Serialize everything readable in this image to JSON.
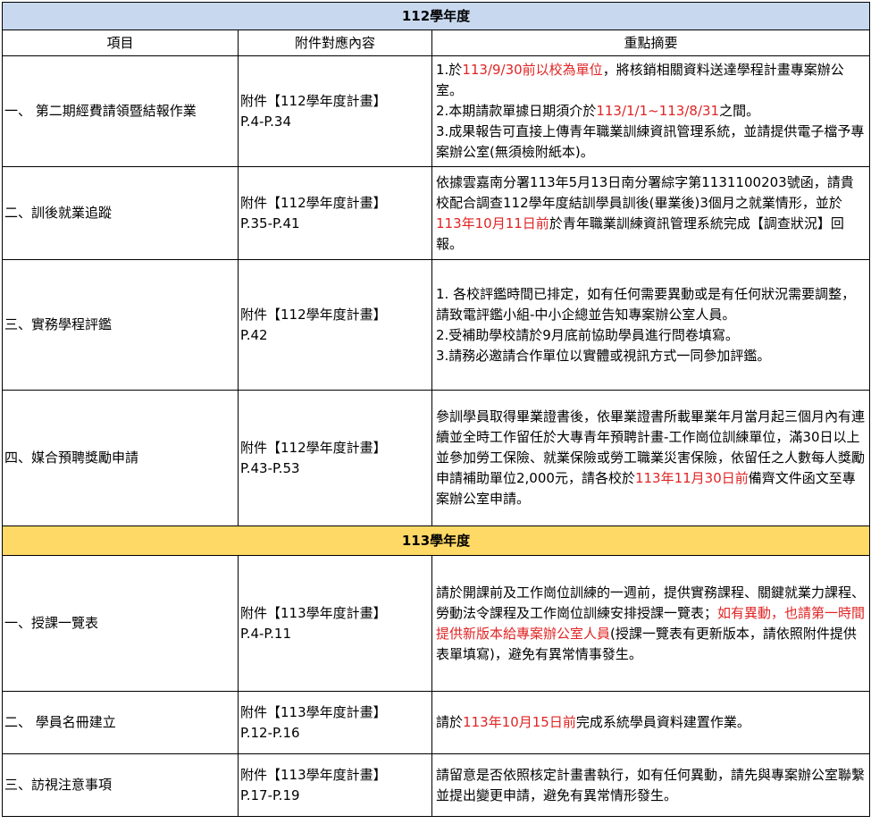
{
  "sections": [
    {
      "year": "112學年度",
      "headers": [
        "項目",
        "附件對應內容",
        "重點摘要"
      ],
      "rows": [
        {
          "item": "一、 第二期經費請領暨結報作業",
          "attach1": "附件【112學年度計畫】",
          "attach2": "P.4-P.34",
          "summary": [
            [
              {
                "t": "1.於"
              },
              {
                "t": "113/9/30前以校為單位",
                "red": true
              },
              {
                "t": "，將核銷相關資料送達學程計畫專案辦公室。"
              }
            ],
            [
              {
                "t": "2.本期請款單據日期須介於"
              },
              {
                "t": "113/1/1~113/8/31",
                "red": true
              },
              {
                "t": "之間。"
              }
            ],
            [
              {
                "t": "3.成果報告可直接上傳青年職業訓練資訊管理系統，並請提供電子檔予專案辦公室(無須檢附紙本)。"
              }
            ]
          ]
        },
        {
          "item": "二、訓後就業追蹤",
          "attach1": "附件【112學年度計畫】",
          "attach2": "P.35-P.41",
          "summary": [
            [
              {
                "t": "依據雲嘉南分署113年5月13日南分署綜字第1131100203號函，請貴校配合調查112學年度結訓學員訓後(畢業後)3個月之就業情形，並於"
              },
              {
                "t": "113年10月11日前",
                "red": true
              },
              {
                "t": "於青年職業訓練資訊管理系統完成【調查狀況】回報。"
              }
            ]
          ]
        },
        {
          "item": "三、實務學程評鑑",
          "attach1": "附件【112學年度計畫】",
          "attach2": "P.42",
          "summary": [
            [
              {
                "t": "1. 各校評鑑時間已排定，如有任何需要異動或是有任何狀況需要調整，請致電評鑑小組-中小企總並告知專案辦公室人員。"
              }
            ],
            [
              {
                "t": "2.受補助學校請於9月底前協助學員進行問卷填寫。"
              }
            ],
            [
              {
                "t": "3.請務必邀請合作單位以實體或視訊方式一同參加評鑑。"
              }
            ]
          ]
        },
        {
          "item": "四、媒合預聘獎勵申請",
          "attach1": "附件【112學年度計畫】",
          "attach2": "P.43-P.53",
          "summary": [
            [
              {
                "t": "參訓學員取得畢業證書後，依畢業證書所載畢業年月當月起三個月內有連續並全時工作留任於大專青年預聘計畫-工作崗位訓練單位，滿30日以上並參加勞工保險、就業保險或勞工職業災害保險，依留任之人數每人獎勵申請補助單位2,000元，請各校於"
              },
              {
                "t": "113年11月30日前",
                "red": true
              },
              {
                "t": "備齊文件函文至專案辦公室申請。"
              }
            ]
          ]
        }
      ]
    },
    {
      "year": "113學年度",
      "rows": [
        {
          "item": "一、授課一覽表",
          "attach1": "附件【113學年度計畫】",
          "attach2": "P.4-P.11",
          "summary": [
            [
              {
                "t": "請於開課前及工作崗位訓練的一週前，提供實務課程、關鍵就業力課程、勞動法令課程及工作崗位訓練安排授課一覽表；"
              },
              {
                "t": "如有異動，也請第一時間提供新版本給專案辦公室人員",
                "red": true
              },
              {
                "t": "(授課一覽表有更新版本，請依照附件提供表單填寫)，避免有異常情事發生。"
              }
            ]
          ]
        },
        {
          "item": "二、 學員名冊建立",
          "attach1": "附件【113學年度計畫】",
          "attach2": "P.12-P.16",
          "summary": [
            [
              {
                "t": "請於"
              },
              {
                "t": "113年10月15日前",
                "red": true
              },
              {
                "t": "完成系統學員資料建置作業。"
              }
            ]
          ]
        },
        {
          "item": "三、訪視注意事項",
          "attach1": "附件【113學年度計畫】",
          "attach2": "P.17-P.19",
          "summary": [
            [
              {
                "t": "請留意是否依照核定計畫書執行，如有任何異動，請先與專案辦公室聯繫並提出變更申請，避免有異常情形發生。"
              }
            ]
          ]
        }
      ]
    }
  ]
}
